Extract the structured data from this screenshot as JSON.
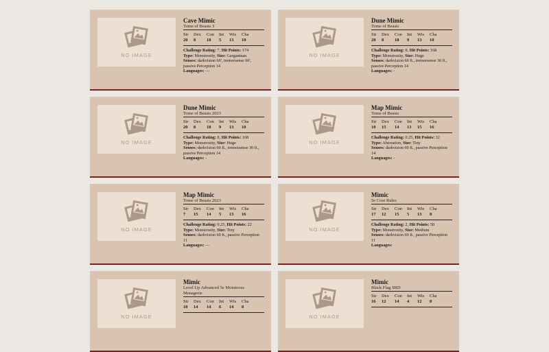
{
  "placeholder_text": "NO IMAGE",
  "stat_labels": [
    "Str",
    "Dex",
    "Con",
    "Int",
    "Wis",
    "Cha"
  ],
  "detail_labels": {
    "cr": "Challenge Rating:",
    "hp": "Hit Points:",
    "type": "Type:",
    "size": "Size:",
    "senses": "Senses:",
    "languages": "Languages:"
  },
  "colors": {
    "background": "#ebe7e2",
    "card": "#d9c3b1",
    "accent_border": "#7a1f24",
    "thumbnail": "#eedfd3"
  },
  "cards": [
    {
      "name": "Cave Mimic",
      "source": "Tome of Beasts 3",
      "stats": [
        "20",
        "8",
        "18",
        "5",
        "13",
        "10"
      ],
      "cr": "7,",
      "hp": "174",
      "type": "Monstrosity,",
      "size": "Gargantuan",
      "senses": "darkvision 60', tremorsense 60', passive Perception 14",
      "languages": "—"
    },
    {
      "name": "Dune Mimic",
      "source": "Tome of Beasts",
      "stats": [
        "20",
        "8",
        "18",
        "9",
        "13",
        "10"
      ],
      "cr": "8,",
      "hp": "168",
      "type": "Monstrosity,",
      "size": "Huge",
      "senses": "darkvision 60 ft., tremorsense 30 ft., passive Perception 14",
      "languages": "-"
    },
    {
      "name": "Dune Mimic",
      "source": "Tome of Beasts 2023",
      "stats": [
        "20",
        "8",
        "18",
        "9",
        "13",
        "10"
      ],
      "cr": "8,",
      "hp": "168",
      "type": "Monstrosity,",
      "size": "Huge",
      "senses": "darkvision 60 ft., tremorsense 30 ft., passive Perception 14",
      "languages": "-"
    },
    {
      "name": "Map Mimic",
      "source": "Tome of Beasts",
      "stats": [
        "10",
        "15",
        "14",
        "13",
        "15",
        "16"
      ],
      "cr": "0.25,",
      "hp": "32",
      "type": "Aberration,",
      "size": "Tiny",
      "senses": "darkvision 60 ft., passive Perception 14",
      "languages": "-"
    },
    {
      "name": "Map Mimic",
      "source": "Tome of Beasts 2023",
      "stats": [
        "7",
        "15",
        "14",
        "5",
        "13",
        "16"
      ],
      "cr": "0.25,",
      "hp": "22",
      "type": "Monstrosity,",
      "size": "Tiny",
      "senses": "darkvision 60 ft., passive Perception 11",
      "languages": "—"
    },
    {
      "name": "Mimic",
      "source": "5e Core Rules",
      "stats": [
        "17",
        "12",
        "15",
        "5",
        "13",
        "8"
      ],
      "cr": "2,",
      "hp": "58",
      "type": "Monstrosity,",
      "size": "Medium",
      "senses": "darkvision 60 ft., passive Perception 11",
      "languages": ""
    },
    {
      "name": "Mimic",
      "source": "Level Up Advanced 5e Monstrous Menagerie",
      "stats": [
        "18",
        "14",
        "14",
        "6",
        "14",
        "8"
      ],
      "cr": "",
      "hp": "",
      "type": "",
      "size": "",
      "senses": "",
      "languages": ""
    },
    {
      "name": "Mimic",
      "source": "Black Flag SRD",
      "stats": [
        "16",
        "12",
        "14",
        "4",
        "12",
        "8"
      ],
      "cr": "",
      "hp": "",
      "type": "",
      "size": "",
      "senses": "",
      "languages": ""
    }
  ]
}
